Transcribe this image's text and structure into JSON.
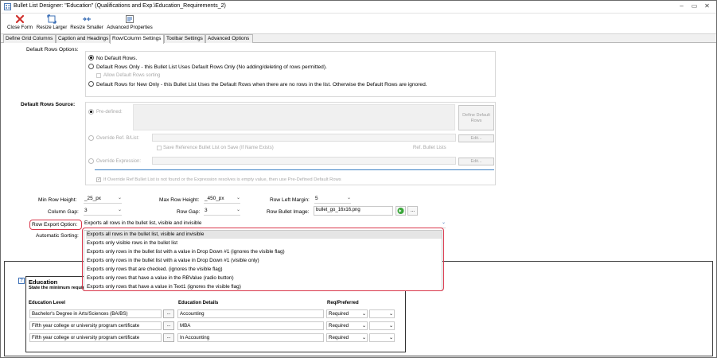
{
  "window": {
    "title": "Bullet List Designer: \"Education\" (Qualifications and Exp.\\Education_Requirements_2)"
  },
  "ribbon": {
    "buttons": [
      {
        "label": "Close Form",
        "icon": "close-form-icon"
      },
      {
        "label": "Resize Larger",
        "icon": "resize-larger-icon"
      },
      {
        "label": "Resize Smaller",
        "icon": "resize-smaller-icon"
      },
      {
        "label": "Advanced Properties",
        "icon": "advanced-properties-icon"
      }
    ]
  },
  "tabs": [
    {
      "label": "Define Grid Columns"
    },
    {
      "label": "Caption and Headings"
    },
    {
      "label": "Row/Column Settings",
      "active": true
    },
    {
      "label": "Toolbar Settings"
    },
    {
      "label": "Advanced Options"
    }
  ],
  "default_rows": {
    "label": "Default Rows Options:",
    "options": [
      {
        "label": "No Default Rows.",
        "selected": true
      },
      {
        "label": "Default Rows Only - this Bullet List Uses Default Rows Only  (No adding/deleting of rows permitted).",
        "selected": false
      },
      {
        "label": "Default Rows for New Only - this Bullet List Uses the Default Rows when there are no rows in the list. Otherwise the Default Rows are ignored.",
        "selected": false
      }
    ],
    "allow_sorting_label": "Allow Default Rows sorting"
  },
  "default_rows_source": {
    "label": "Default Rows Source:",
    "predefined_label": "Pre-defined:",
    "define_button": "Define Default Rows",
    "override_ref_label": "Override Ref. B/List:",
    "save_reference_label": "Save Reference Bullet List on Save (If Name Exists)",
    "ref_bullet_lists_label": "Ref. Bullet Lists",
    "override_expr_label": "Override Expression:",
    "edit_label": "Edit...",
    "fallback_label": "If Override Ref Bullet List is not found or the Expression resolves is empty value, then use Pre-Defined Default Rows"
  },
  "settings": {
    "min_row_height_label": "Min Row Height:",
    "min_row_height": "_25_px",
    "max_row_height_label": "Max Row Height:",
    "max_row_height": "_450_px",
    "row_left_margin_label": "Row Left Margin:",
    "row_left_margin": "5",
    "column_gap_label": "Column Gap:",
    "column_gap": "3",
    "row_gap_label": "Row Gap:",
    "row_gap": "3",
    "row_bullet_image_label": "Row Bullet Image:",
    "row_bullet_image": "bullet_go_16x16.png",
    "row_export_label": "Row Export Option:",
    "row_export_value": "Exports all rows in the bullet list, visible and invisible",
    "automatic_sorting_label": "Automatic Sorting:"
  },
  "export_options": [
    "Exports all rows in the bullet list, visible and invisible",
    "Exports only visible rows in the bullet list",
    "Exports only rows in the bullet list with a value in Drop Down #1 (ignores the visible flag)",
    "Exports only rows in the bullet list with a value in Drop Down #1 (visible only)",
    "Exports only rows that are checked. (ignores the visible flag)",
    "Exports only rows that have a value in the RBValue (radio button)",
    "Exports only rows that have a value in Text1 (ignores the visible flag)"
  ],
  "preview": {
    "help_icon": "?",
    "title": "Education",
    "subtitle": "State the minimum require",
    "headers": [
      "Education Level",
      "Education Details",
      "Req/Preferred"
    ],
    "rows": [
      {
        "level": "Bachelor's Degree in Arts/Sciences (BA/BS)",
        "details": "Accounting",
        "req": "Required"
      },
      {
        "level": "Fifth year college or university program certificate",
        "details": "MBA",
        "req": "Required"
      },
      {
        "level": "Fifth year college or university program certificate",
        "details": "In Accounting",
        "req": "Required"
      }
    ],
    "ellipsis": "..."
  },
  "colors": {
    "highlight_border": "#d9374b",
    "selected_option": "#e5e5e5"
  }
}
